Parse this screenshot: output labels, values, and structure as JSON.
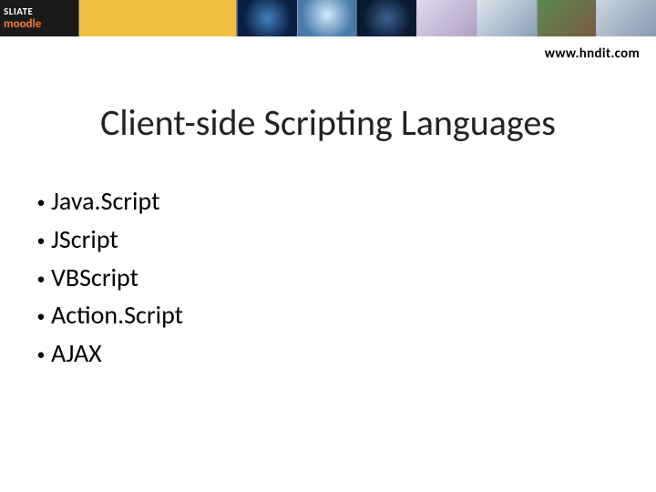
{
  "banner": {
    "logo_top": "SLIATE",
    "logo_bottom": "moodle"
  },
  "url": "www.hndit.com",
  "title": "Client-side Scripting Languages",
  "bullets": [
    "Java.Script",
    "JScript",
    "VBScript",
    "Action.Script",
    "AJAX"
  ]
}
